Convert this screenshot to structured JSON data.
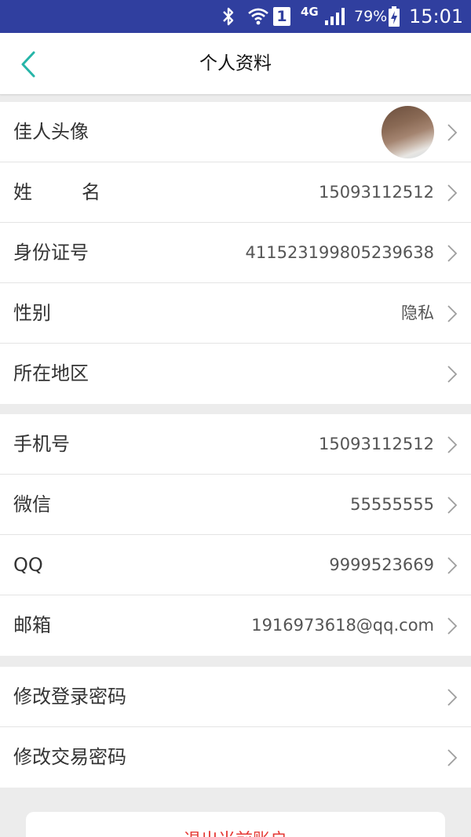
{
  "status_bar": {
    "network": "4G",
    "sim": "1",
    "battery": "79%",
    "time": "15:01"
  },
  "header": {
    "title": "个人资料"
  },
  "profile": {
    "avatar_label": "佳人头像",
    "name_label_a": "姓",
    "name_label_b": "名",
    "name_value": "15093112512",
    "id_label": "身份证号",
    "id_value": "411523199805239638",
    "gender_label": "性别",
    "gender_value": "隐私",
    "region_label": "所在地区",
    "region_value": ""
  },
  "contact": {
    "phone_label": "手机号",
    "phone_value": "15093112512",
    "wechat_label": "微信",
    "wechat_value": "55555555",
    "qq_label": "QQ",
    "qq_value": "9999523669",
    "email_label": "邮箱",
    "email_value": "1916973618@qq.com"
  },
  "security": {
    "login_pwd_label": "修改登录密码",
    "trade_pwd_label": "修改交易密码"
  },
  "logout": {
    "label": "退出当前账户"
  },
  "colors": {
    "status_bar": "#303f9f",
    "accent": "#26b5a8",
    "logout_text": "#e53935"
  }
}
